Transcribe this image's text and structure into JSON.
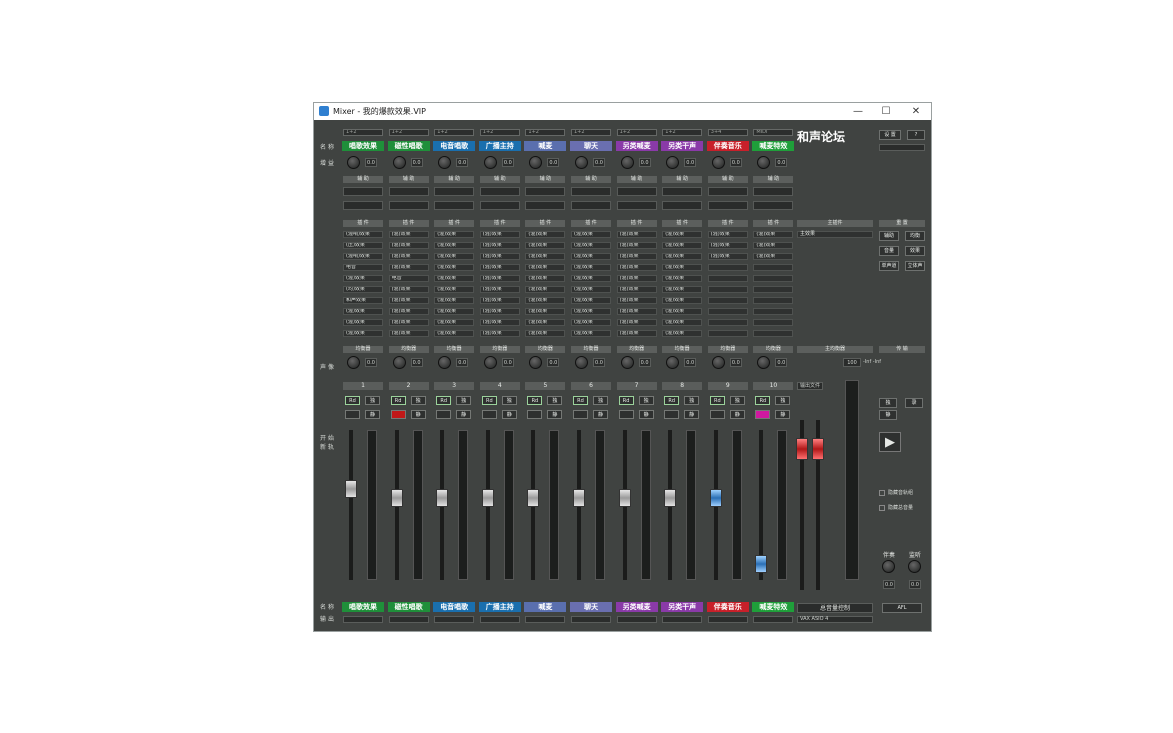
{
  "window": {
    "title": "Mixer - 我的爆款效果.VIP",
    "minimize_glyph": "—",
    "maximize_glyph": "☐",
    "close_glyph": "✕"
  },
  "row_labels": {
    "name": "名 称",
    "gain": "增 益",
    "pan": "声 像",
    "record": "开 始",
    "arm": "新 轨",
    "name_bottom": "名 称",
    "output": "输 出"
  },
  "headers": {
    "aux": "辅 助",
    "insert": "插 件",
    "eq": "均衡器",
    "master_insert": "主插件",
    "master_eq": "主均衡器",
    "settings": "设 置",
    "help": "?",
    "reset": "重 置",
    "transport": "传 输"
  },
  "brand": "和声论坛",
  "channels": [
    {
      "route": "1+2",
      "name": "唱歌效果",
      "color": "#1f8f3a",
      "num": "1",
      "gain": "0.0",
      "ins": [
        "(混响)效果",
        "(压)效果",
        "(混响)效果",
        "电音",
        "(混)效果",
        "(均)效果",
        "和声效果",
        "(混)效果",
        "(混)效果",
        "(混)效果"
      ]
    },
    {
      "route": "1+2",
      "name": "磁性唱歌",
      "color": "#1f8f3a",
      "num": "2",
      "gain": "0.0",
      "ins": [
        "(混)效果",
        "(混)效果",
        "(混)效果",
        "(混)效果",
        "电音",
        "(混)效果",
        "(混)效果",
        "(混)效果",
        "(混)效果",
        "(混)效果"
      ]
    },
    {
      "route": "1+2",
      "name": "电音唱歌",
      "color": "#1a6fae",
      "num": "3",
      "gain": "0.0",
      "ins": [
        "(混)效果",
        "(混)效果",
        "(混)效果",
        "(混)效果",
        "(混)效果",
        "(混)效果",
        "(混)效果",
        "(混)效果",
        "(混)效果",
        "(混)效果"
      ]
    },
    {
      "route": "1+2",
      "name": "广播主持",
      "color": "#1a6fae",
      "num": "4",
      "gain": "0.0",
      "ins": [
        "(混)效果",
        "(混)效果",
        "(混)效果",
        "(混)效果",
        "(混)效果",
        "(混)效果",
        "(混)效果",
        "(混)效果",
        "(混)效果",
        "(混)效果"
      ]
    },
    {
      "route": "1+2",
      "name": "喊麦",
      "color": "#5a6fae",
      "num": "5",
      "gain": "0.0",
      "ins": [
        "(混)效果",
        "(混)效果",
        "(混)效果",
        "(混)效果",
        "(混)效果",
        "(混)效果",
        "(混)效果",
        "(混)效果",
        "(混)效果",
        "(混)效果"
      ]
    },
    {
      "route": "1+2",
      "name": "聊天",
      "color": "#6a6fb0",
      "num": "6",
      "gain": "0.0",
      "ins": [
        "(混)效果",
        "(混)效果",
        "(混)效果",
        "(混)效果",
        "(混)效果",
        "(混)效果",
        "(混)效果",
        "(混)效果",
        "(混)效果",
        "(混)效果"
      ]
    },
    {
      "route": "1+2",
      "name": "另类喊麦",
      "color": "#8a3aa8",
      "num": "7",
      "gain": "0.0",
      "ins": [
        "(混)效果",
        "(混)效果",
        "(混)效果",
        "(混)效果",
        "(混)效果",
        "(混)效果",
        "(混)效果",
        "(混)效果",
        "(混)效果",
        "(混)效果"
      ]
    },
    {
      "route": "1+2",
      "name": "另类干声",
      "color": "#8a3aa8",
      "num": "8",
      "gain": "0.0",
      "ins": [
        "(混)效果",
        "(混)效果",
        "(混)效果",
        "(混)效果",
        "(混)效果",
        "(混)效果",
        "(混)效果",
        "(混)效果",
        "(混)效果",
        "(混)效果"
      ]
    },
    {
      "route": "3+4",
      "name": "伴奏音乐",
      "color": "#c8202a",
      "num": "9",
      "gain": "0.0",
      "ins": [
        "(混)效果",
        "(混)效果",
        "(混)效果",
        "",
        "",
        "",
        "",
        "",
        "",
        ""
      ]
    },
    {
      "route": "MIDI",
      "name": "喊麦特效",
      "color": "#1f9f3a",
      "num": "10",
      "gain": "0.0",
      "ins": [
        "(混)效果",
        "(混)效果",
        "(混)效果",
        "",
        "",
        "",
        "",
        "",
        "",
        ""
      ]
    }
  ],
  "master": {
    "name": "总音量控制",
    "output": "VAX ASIO 4",
    "pan_value": "100",
    "reading": "-Inf -Inf",
    "mode": "输出文件",
    "insert_first": "主效果"
  },
  "side": {
    "buttons": [
      "辅助",
      "均衡",
      "音量",
      "效果",
      "单声道",
      "立体声"
    ],
    "mute": "静",
    "solo": "独",
    "rec": "录",
    "play_label": "▶",
    "knob1": "0.0",
    "knob2": "0.0",
    "label1": "伴奏",
    "label2": "监听",
    "hide1": "隐藏音轨组",
    "hide2": "隐藏总音量",
    "afl": "AFL"
  },
  "strip_buttons": {
    "rd": "Rd",
    "w": "独",
    "m": "静"
  },
  "colors": {
    "window_bg": "#404341",
    "accent_green": "#1f8f3a"
  }
}
